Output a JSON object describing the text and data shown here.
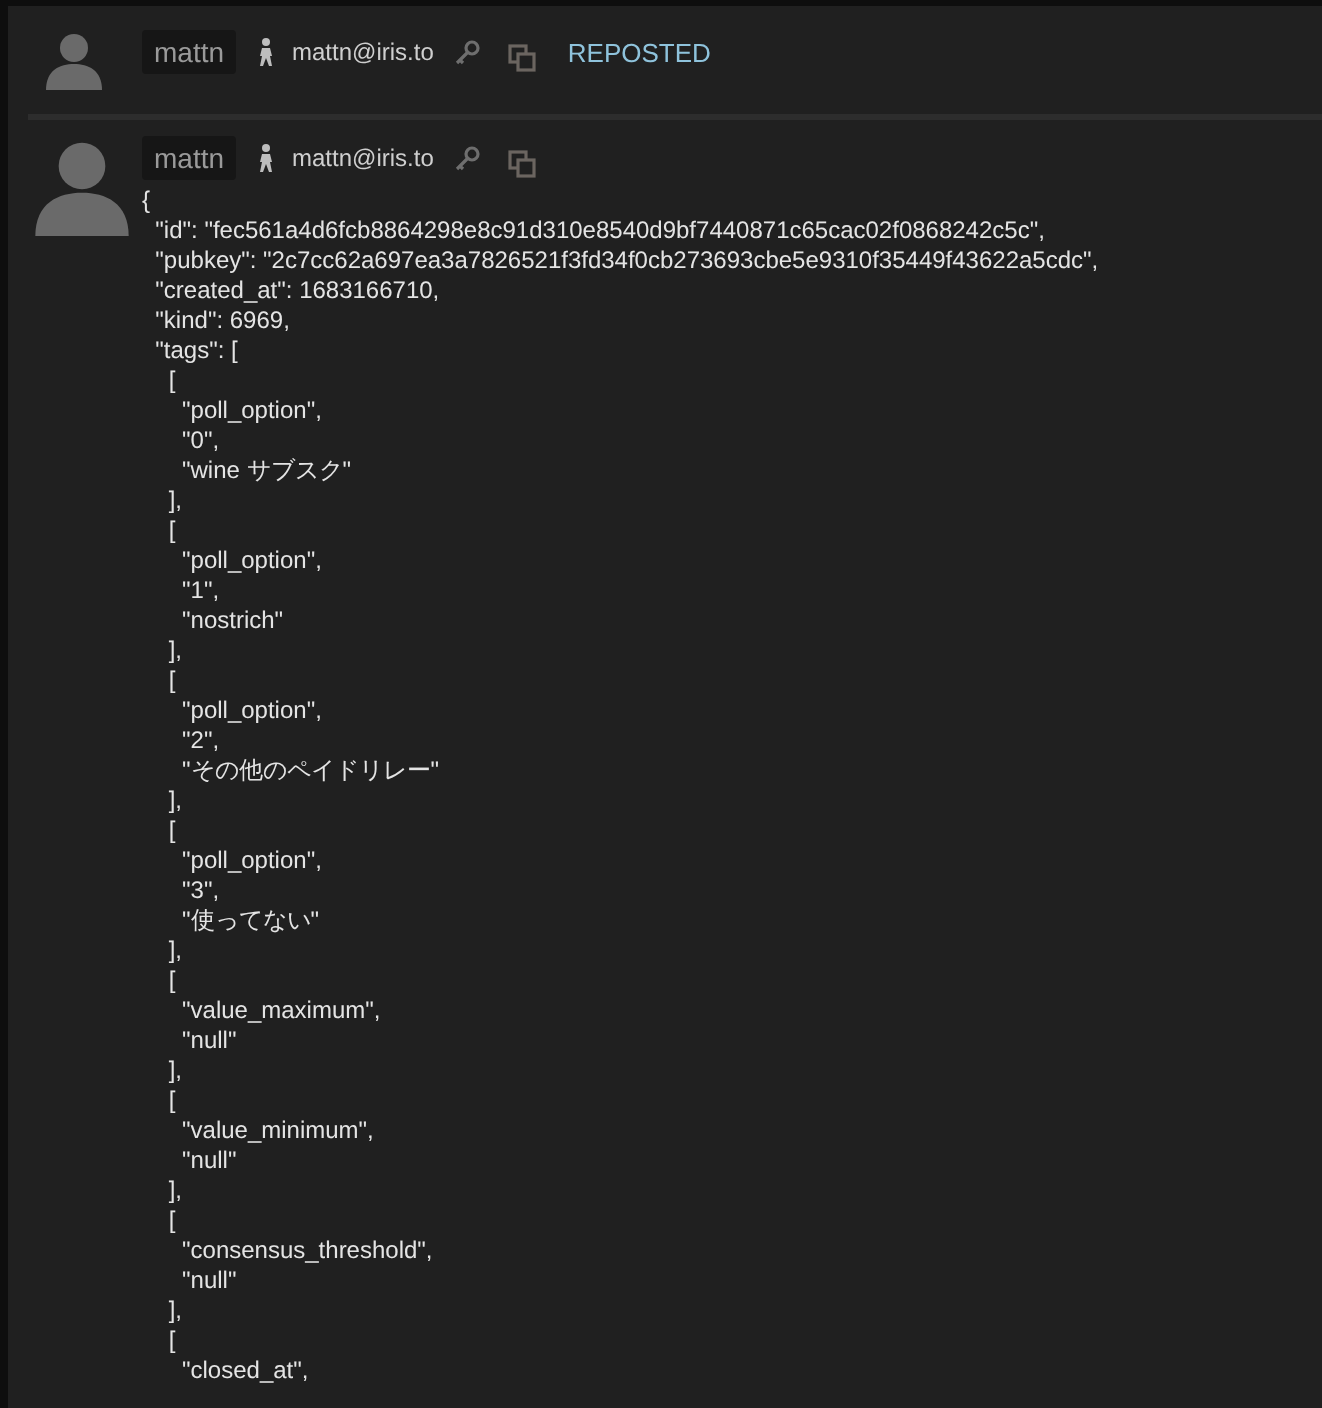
{
  "repost": {
    "author": {
      "name": "mattn",
      "nip05": "mattn@iris.to"
    },
    "label": "REPOSTED"
  },
  "post": {
    "author": {
      "name": "mattn",
      "nip05": "mattn@iris.to"
    },
    "content": "{\n  \"id\": \"fec561a4d6fcb8864298e8c91d310e8540d9bf7440871c65cac02f0868242c5c\",\n  \"pubkey\": \"2c7cc62a697ea3a7826521f3fd34f0cb273693cbe5e9310f35449f43622a5cdc\",\n  \"created_at\": 1683166710,\n  \"kind\": 6969,\n  \"tags\": [\n    [\n      \"poll_option\",\n      \"0\",\n      \"wine サブスク\"\n    ],\n    [\n      \"poll_option\",\n      \"1\",\n      \"nostrich\"\n    ],\n    [\n      \"poll_option\",\n      \"2\",\n      \"その他のペイドリレー\"\n    ],\n    [\n      \"poll_option\",\n      \"3\",\n      \"使ってない\"\n    ],\n    [\n      \"value_maximum\",\n      \"null\"\n    ],\n    [\n      \"value_minimum\",\n      \"null\"\n    ],\n    [\n      \"consensus_threshold\",\n      \"null\"\n    ],\n    [\n      \"closed_at\","
  }
}
